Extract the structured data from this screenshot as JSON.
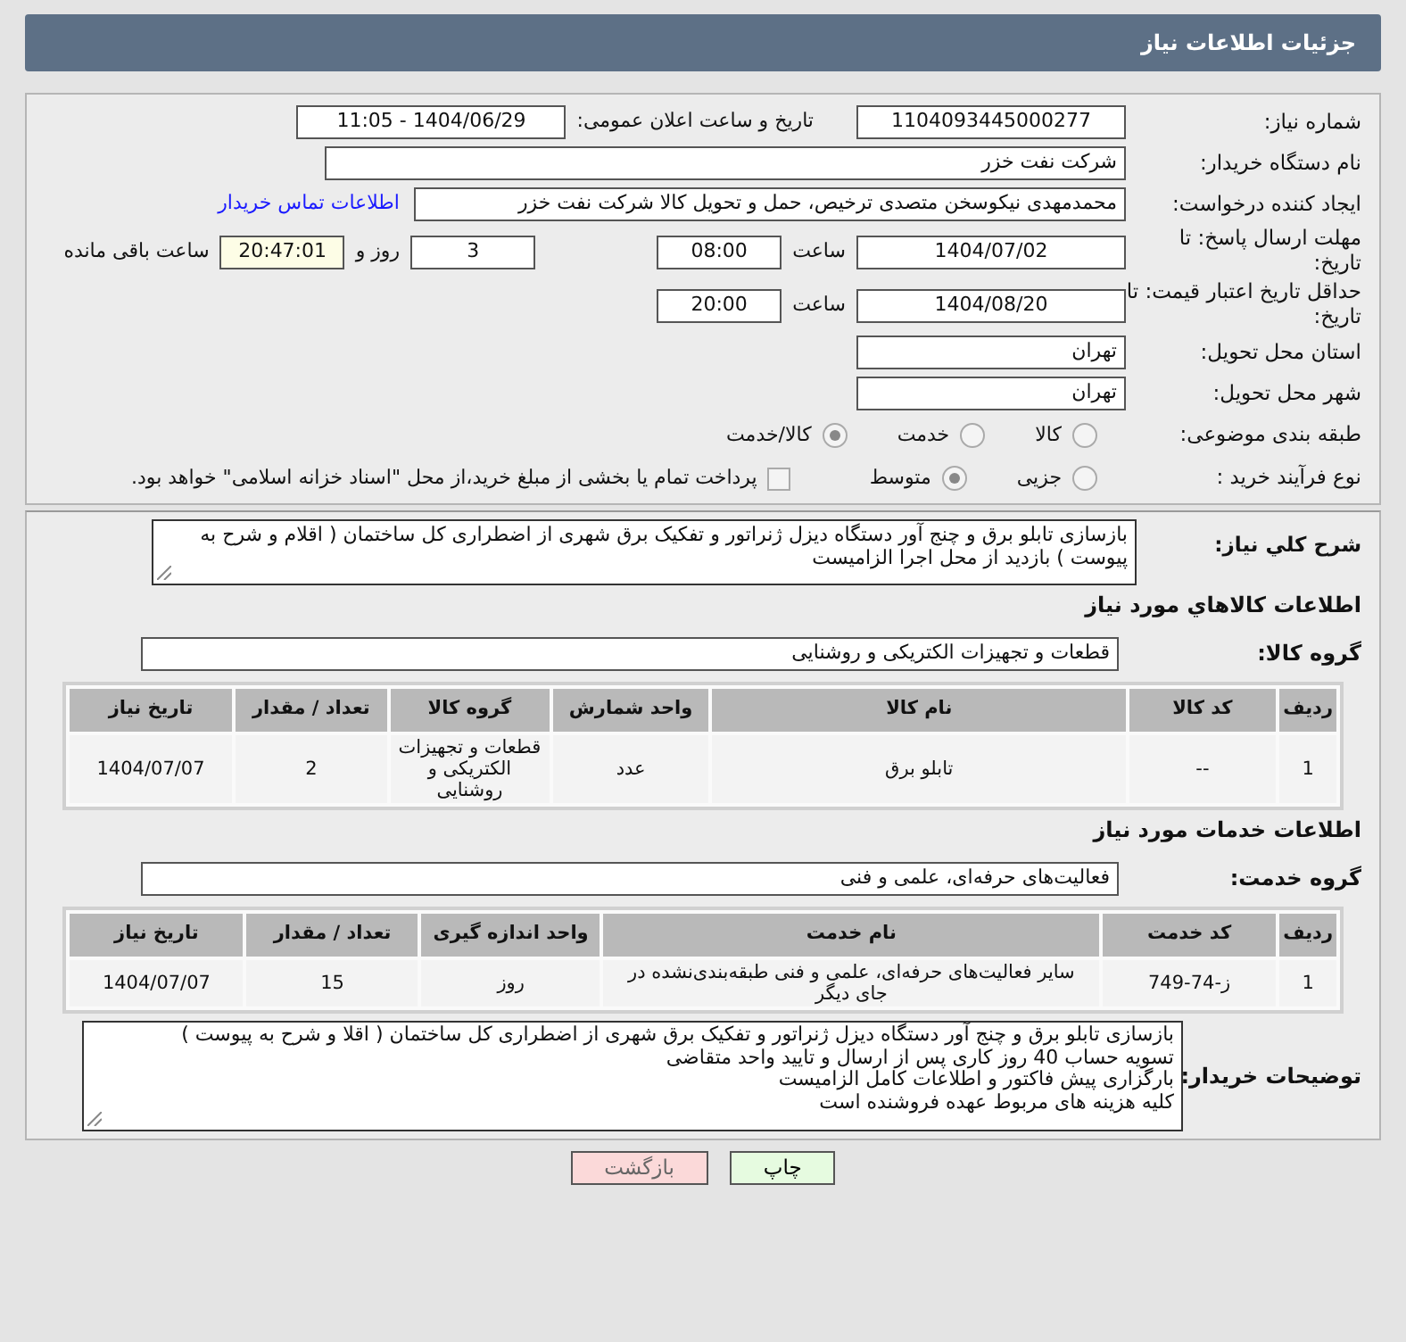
{
  "header": {
    "title": "جزئیات اطلاعات نیاز"
  },
  "need_number": {
    "label": "شماره نیاز:",
    "value": "1104093445000277"
  },
  "announce": {
    "label": "تاریخ و ساعت اعلان عمومی:",
    "value": "1404/06/29 - 11:05"
  },
  "buyer": {
    "label": "نام دستگاه خریدار:",
    "value": "شرکت نفت خزر"
  },
  "requester": {
    "label": "ایجاد کننده درخواست:",
    "value": "محمدمهدی نیکوسخن متصدی ترخیص، حمل و تحویل کالا شرکت نفت خزر",
    "link": "اطلاعات تماس خریدار"
  },
  "deadline": {
    "label": "مهلت ارسال پاسخ: تا تاریخ:",
    "date": "1404/07/02",
    "time_label": "ساعت",
    "time": "08:00",
    "days": "3",
    "days_label": "روز و",
    "remaining": "20:47:01",
    "remaining_label": "ساعت باقی مانده"
  },
  "validity": {
    "label": "حداقل تاریخ اعتبار قیمت: تا تاریخ:",
    "date": "1404/08/20",
    "time_label": "ساعت",
    "time": "20:00"
  },
  "province": {
    "label": "استان محل تحویل:",
    "value": "تهران"
  },
  "city": {
    "label": "شهر محل تحویل:",
    "value": "تهران"
  },
  "category": {
    "label": "طبقه بندی موضوعی:",
    "options": [
      {
        "label": "کالا",
        "selected": false
      },
      {
        "label": "خدمت",
        "selected": false
      },
      {
        "label": "کالا/خدمت",
        "selected": true
      }
    ]
  },
  "process": {
    "label": "نوع فرآیند خرید :",
    "options": [
      {
        "label": "جزیی",
        "selected": false
      },
      {
        "label": "متوسط",
        "selected": true
      }
    ],
    "treasury": {
      "checked": false,
      "text": "پرداخت تمام یا بخشی از مبلغ خرید،از محل \"اسناد خزانه اسلامی\" خواهد بود."
    }
  },
  "description": {
    "label": "شرح کلي نیاز:",
    "value": "بازسازی تابلو برق و چنج آور دستگاه دیزل ژنراتور و تفکیک برق شهری از اضطراری کل ساختمان ( اقلام و شرح به پیوست ) بازدید از محل اجرا الزامیست"
  },
  "goods": {
    "title": "اطلاعات کالاهاي مورد نیاز",
    "group_label": "گروه کالا:",
    "group": "قطعات و تجهیزات الکتریکی و روشنایی",
    "table": {
      "columns": [
        "ردیف",
        "کد کالا",
        "نام کالا",
        "واحد شمارش",
        "گروه کالا",
        "تعداد / مقدار",
        "تاریخ نیاز"
      ],
      "rows": [
        [
          "1",
          "--",
          "تابلو برق",
          "عدد",
          "قطعات و تجهیزات الکتریکی و روشنایی",
          "2",
          "1404/07/07"
        ]
      ]
    }
  },
  "services": {
    "title": "اطلاعات خدمات مورد نیاز",
    "group_label": "گروه خدمت:",
    "group": "فعالیت‌های حرفه‌ای، علمی و فنی",
    "table": {
      "columns": [
        "ردیف",
        "کد خدمت",
        "نام خدمت",
        "واحد اندازه گیری",
        "تعداد / مقدار",
        "تاریخ نیاز"
      ],
      "rows": [
        [
          "1",
          "ز-74-749",
          "سایر فعالیت‌های حرفه‌ای، علمی و فنی طبقه‌بندی‌نشده در جای دیگر",
          "روز",
          "15",
          "1404/07/07"
        ]
      ]
    }
  },
  "buyer_notes": {
    "label": "توضیحات خریدار:",
    "lines": [
      "بازسازی تابلو برق و چنج آور دستگاه دیزل ژنراتور و تفکیک برق شهری از اضطراری کل ساختمان ( اقلا و شرح به پیوست )",
      "تسویه حساب 40 روز کاری پس از ارسال و تایید واحد متقاضی",
      "بارگزاری پیش فاکتور و اطلاعات کامل الزامیست",
      "کلیه هزینه های مربوط عهده فروشنده است"
    ]
  },
  "buttons": [
    {
      "label": "چاپ",
      "kind": "print"
    },
    {
      "label": "بازگشت",
      "kind": "back"
    }
  ]
}
